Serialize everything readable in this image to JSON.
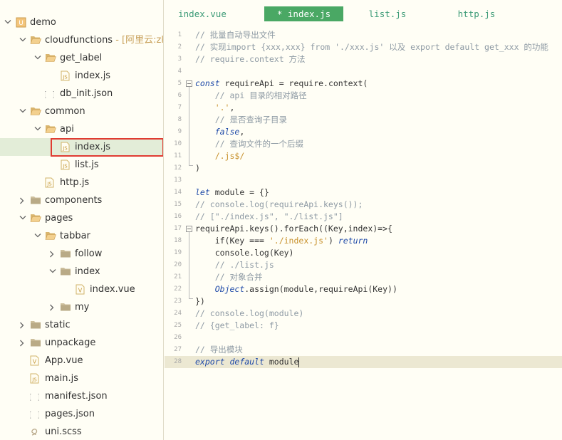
{
  "sidebar": {
    "items": [
      {
        "label": "demo",
        "icon": "project-icon",
        "expanded": true
      },
      {
        "label": "cloudfunctions",
        "tail": " - [阿里云:zk-d",
        "icon": "folder-open-icon",
        "expanded": true
      },
      {
        "label": "get_label",
        "icon": "folder-open-icon",
        "expanded": true
      },
      {
        "label": "index.js",
        "icon": "js-file-icon"
      },
      {
        "label": "db_init.json",
        "icon": "json-file-icon"
      },
      {
        "label": "common",
        "icon": "folder-open-icon",
        "expanded": true
      },
      {
        "label": "api",
        "icon": "folder-open-icon",
        "expanded": true
      },
      {
        "label": "index.js",
        "icon": "js-file-icon",
        "selected": true
      },
      {
        "label": "list.js",
        "icon": "js-file-icon"
      },
      {
        "label": "http.js",
        "icon": "js-file-icon"
      },
      {
        "label": "components",
        "icon": "folder-icon",
        "expanded": false
      },
      {
        "label": "pages",
        "icon": "folder-open-icon",
        "expanded": true
      },
      {
        "label": "tabbar",
        "icon": "folder-open-icon",
        "expanded": true
      },
      {
        "label": "follow",
        "icon": "folder-icon",
        "expanded": false
      },
      {
        "label": "index",
        "icon": "folder-icon",
        "expanded": true
      },
      {
        "label": "index.vue",
        "icon": "vue-file-icon"
      },
      {
        "label": "my",
        "icon": "folder-icon",
        "expanded": false
      },
      {
        "label": "static",
        "icon": "folder-icon",
        "expanded": false
      },
      {
        "label": "unpackage",
        "icon": "folder-icon",
        "expanded": false
      },
      {
        "label": "App.vue",
        "icon": "vue-file-icon"
      },
      {
        "label": "main.js",
        "icon": "js-file-icon"
      },
      {
        "label": "manifest.json",
        "icon": "json-file-icon"
      },
      {
        "label": "pages.json",
        "icon": "json-file-icon"
      },
      {
        "label": "uni.scss",
        "icon": "scss-file-icon"
      }
    ]
  },
  "tabs": [
    {
      "label": "index.vue",
      "active": false
    },
    {
      "label": "* index.js",
      "active": true
    },
    {
      "label": "list.js",
      "active": false
    },
    {
      "label": "http.js",
      "active": false
    }
  ],
  "editor": {
    "lines": [
      {
        "n": "1",
        "text": "// 批量自动导出文件"
      },
      {
        "n": "2",
        "text": "// 实现import {xxx,xxx} from './xxx.js' 以及 export default get_xxx 的功能"
      },
      {
        "n": "3",
        "text": "// require.context 方法"
      },
      {
        "n": "4",
        "text": ""
      },
      {
        "n": "5",
        "text": "const requireApi = require.context("
      },
      {
        "n": "6",
        "text": "    // api 目录的相对路径"
      },
      {
        "n": "7",
        "text": "    '.',"
      },
      {
        "n": "8",
        "text": "    // 是否查询子目录"
      },
      {
        "n": "9",
        "text": "    false,"
      },
      {
        "n": "10",
        "text": "    // 查询文件的一个后缀"
      },
      {
        "n": "11",
        "text": "    /.js$/"
      },
      {
        "n": "12",
        "text": ")"
      },
      {
        "n": "13",
        "text": ""
      },
      {
        "n": "14",
        "text": "let module = {}"
      },
      {
        "n": "15",
        "text": "// console.log(requireApi.keys());"
      },
      {
        "n": "16",
        "text": "// [\"./index.js\", \"./list.js\"]"
      },
      {
        "n": "17",
        "text": "requireApi.keys().forEach((Key,index)=>{"
      },
      {
        "n": "18",
        "text": "    if(Key === './index.js') return"
      },
      {
        "n": "19",
        "text": "    console.log(Key)"
      },
      {
        "n": "20",
        "text": "    // ./list.js"
      },
      {
        "n": "21",
        "text": "    // 对象合并"
      },
      {
        "n": "22",
        "text": "    Object.assign(module,requireApi(Key))"
      },
      {
        "n": "23",
        "text": "})"
      },
      {
        "n": "24",
        "text": "// console.log(module)"
      },
      {
        "n": "25",
        "text": "// {get_label: f}"
      },
      {
        "n": "26",
        "text": ""
      },
      {
        "n": "27",
        "text": "// 导出模块"
      },
      {
        "n": "28",
        "text": "export default module"
      }
    ]
  }
}
